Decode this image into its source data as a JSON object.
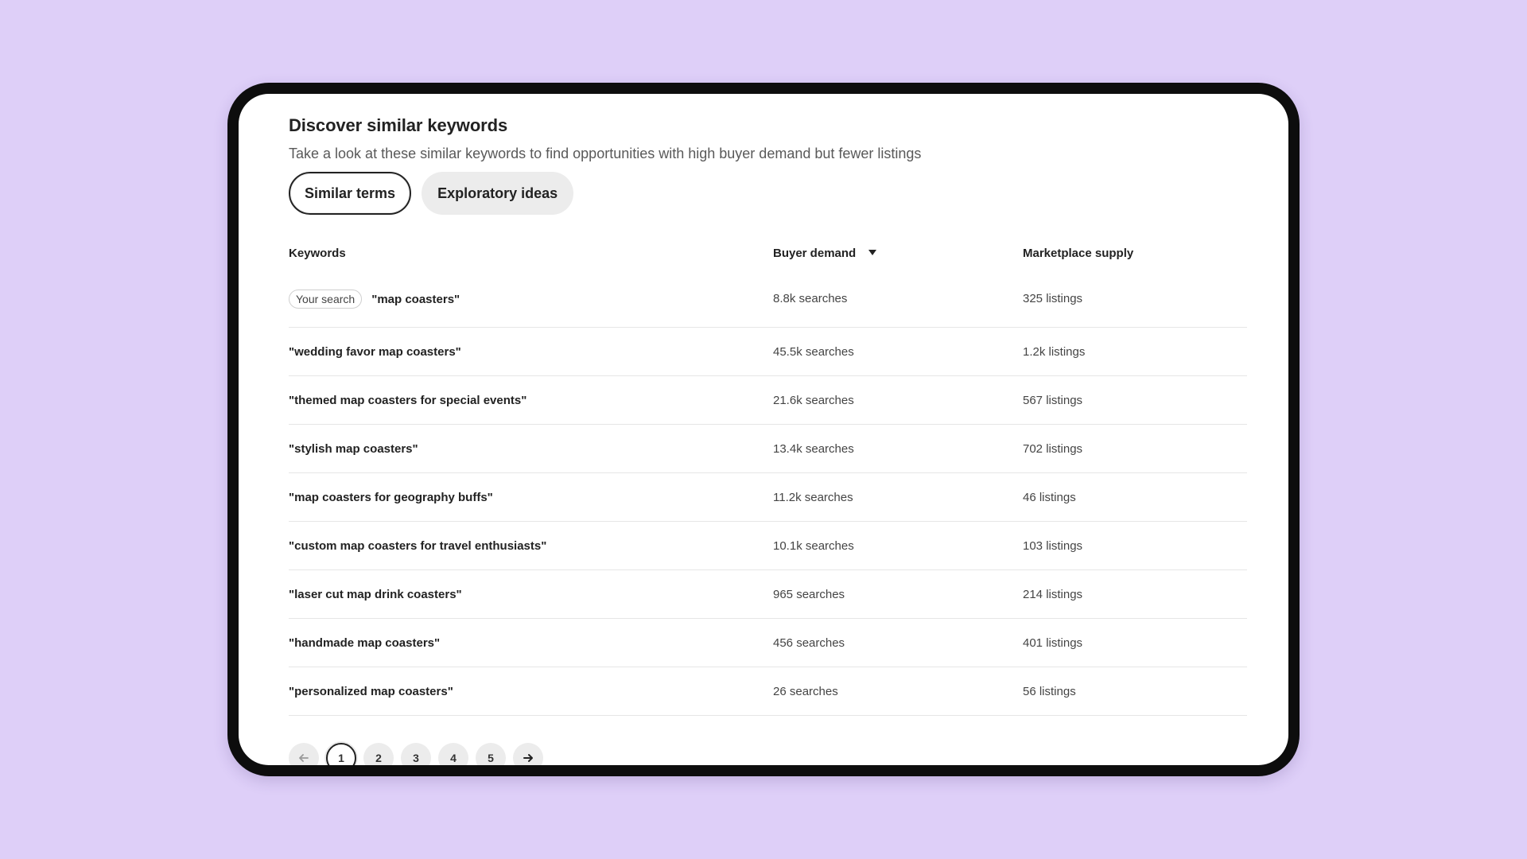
{
  "header": {
    "title": "Discover similar keywords",
    "subtitle": "Take a look at these similar keywords to find opportunities with high buyer demand but fewer listings"
  },
  "tabs": [
    {
      "label": "Similar terms",
      "active": true
    },
    {
      "label": "Exploratory ideas",
      "active": false
    }
  ],
  "table": {
    "columns": {
      "keywords": "Keywords",
      "demand": "Buyer demand",
      "supply": "Marketplace supply"
    },
    "sort_icon": "caret-down-icon",
    "your_search_label": "Your search",
    "rows": [
      {
        "keyword": "\"map coasters\"",
        "demand": "8.8k searches",
        "supply": "325 listings"
      },
      {
        "keyword": "\"wedding favor map coasters\"",
        "demand": "45.5k searches",
        "supply": "1.2k listings"
      },
      {
        "keyword": "\"themed map coasters for special events\"",
        "demand": "21.6k searches",
        "supply": "567 listings"
      },
      {
        "keyword": "\"stylish map coasters\"",
        "demand": "13.4k searches",
        "supply": "702 listings"
      },
      {
        "keyword": "\"map coasters for geography buffs\"",
        "demand": "11.2k searches",
        "supply": "46 listings"
      },
      {
        "keyword": "\"custom map coasters for travel enthusiasts\"",
        "demand": "10.1k searches",
        "supply": "103 listings"
      },
      {
        "keyword": "\"laser cut map drink coasters\"",
        "demand": "965 searches",
        "supply": "214 listings"
      },
      {
        "keyword": "\"handmade map coasters\"",
        "demand": "456 searches",
        "supply": "401 listings"
      },
      {
        "keyword": "\"personalized map coasters\"",
        "demand": "26 searches",
        "supply": "56 listings"
      }
    ]
  },
  "pagination": {
    "pages": [
      "1",
      "2",
      "3",
      "4",
      "5"
    ],
    "current": "1",
    "prev_icon": "arrow-left-icon",
    "next_icon": "arrow-right-icon"
  },
  "colors": {
    "background": "#decff8",
    "frame": "#0d0d0d",
    "text": "#222222"
  }
}
